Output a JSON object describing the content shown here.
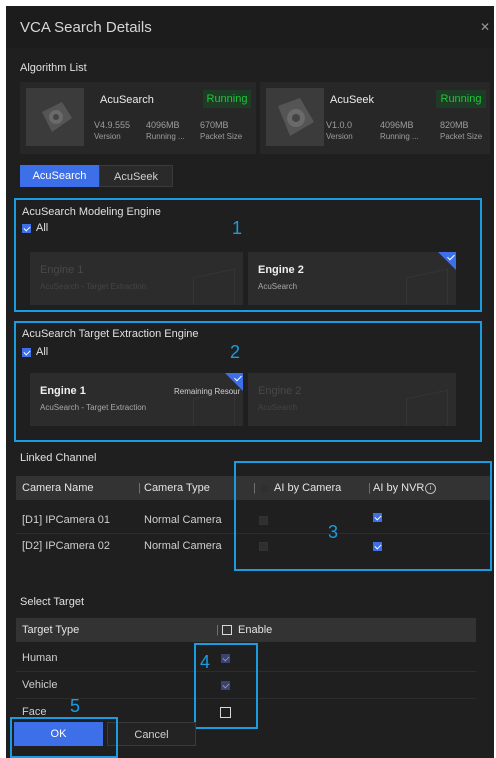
{
  "dialog": {
    "title": "VCA Search Details",
    "close_icon": "close-icon"
  },
  "algorithm_list": {
    "label": "Algorithm List",
    "cards": [
      {
        "name": "AcuSearch",
        "status": "Running",
        "version": "V4.9.555",
        "version_label": "Version",
        "running": "4096MB",
        "running_label": "Running ...",
        "packet": "670MB",
        "packet_label": "Packet Size"
      },
      {
        "name": "AcuSeek",
        "status": "Running",
        "version": "V1.0.0",
        "version_label": "Version",
        "running": "4096MB",
        "running_label": "Running ...",
        "packet": "820MB",
        "packet_label": "Packet Size"
      }
    ]
  },
  "tabs": [
    {
      "label": "AcuSearch",
      "active": true
    },
    {
      "label": "AcuSeek",
      "active": false
    }
  ],
  "modeling": {
    "title": "AcuSearch Modeling Engine",
    "all_label": "All",
    "all_checked": true,
    "engines": [
      {
        "name": "Engine 1",
        "sub": "AcuSearch - Target Extraction",
        "enabled": false,
        "selected": false
      },
      {
        "name": "Engine 2",
        "sub": "AcuSearch",
        "enabled": true,
        "selected": true
      }
    ]
  },
  "extraction": {
    "title": "AcuSearch Target Extraction Engine",
    "all_label": "All",
    "all_checked": true,
    "engines": [
      {
        "name": "Engine 1",
        "sub": "AcuSearch - Target Extraction",
        "badge": "Remaining Resour",
        "enabled": true,
        "selected": true
      },
      {
        "name": "Engine 2",
        "sub": "AcuSearch",
        "enabled": false,
        "selected": false
      }
    ]
  },
  "linked_channel": {
    "label": "Linked Channel",
    "columns": [
      "Camera Name",
      "Camera Type",
      "AI by Camera",
      "AI by NVR"
    ],
    "rows": [
      {
        "name": "[D1] IPCamera 01",
        "type": "Normal Camera",
        "ai_camera": false,
        "ai_nvr": true
      },
      {
        "name": "[D2] IPCamera 02",
        "type": "Normal Camera",
        "ai_camera": false,
        "ai_nvr": true
      }
    ]
  },
  "select_target": {
    "label": "Select Target",
    "columns": [
      "Target Type",
      "Enable"
    ],
    "rows": [
      {
        "type": "Human",
        "enabled": true
      },
      {
        "type": "Vehicle",
        "enabled": true
      },
      {
        "type": "Face",
        "enabled": false
      }
    ]
  },
  "buttons": {
    "ok": "OK",
    "cancel": "Cancel"
  },
  "annotations": [
    "1",
    "2",
    "3",
    "4",
    "5"
  ],
  "colors": {
    "accent": "#3d6fe8",
    "annotation": "#1b9ce2",
    "running": "#21c43d"
  }
}
